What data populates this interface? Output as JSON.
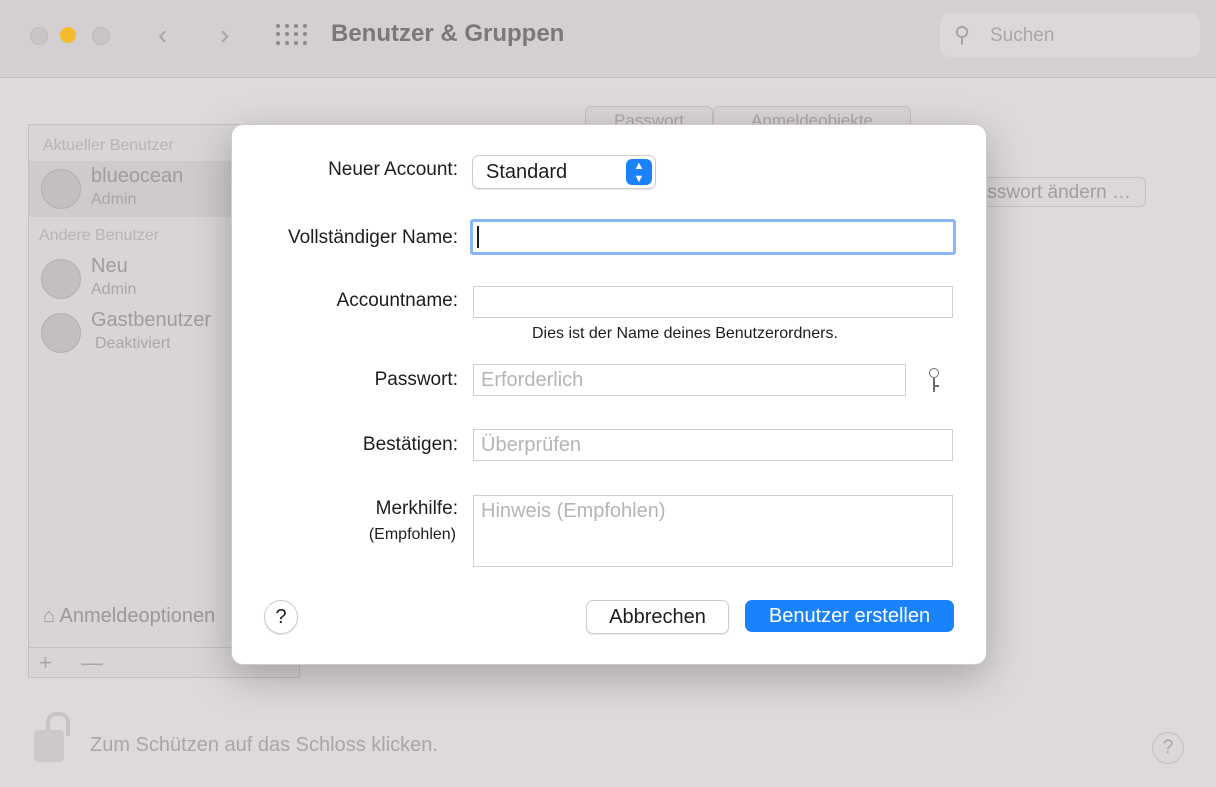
{
  "window": {
    "title": "Benutzer & Gruppen",
    "search_placeholder": "Suchen",
    "back_glyph": "‹",
    "forward_glyph": "›",
    "traffic_lights": {
      "close": "#c9c4c5",
      "minimize": "#f4bc2d",
      "zoom": "#c9c4c5"
    }
  },
  "sidebar": {
    "current_section": "Aktueller Benutzer",
    "other_section": "Andere Benutzer",
    "users": [
      {
        "name": "blueocean",
        "role": "Admin",
        "icon": "user-avatar-icon"
      },
      {
        "name": "Neu",
        "role": "Admin",
        "icon": "user-avatar-icon"
      },
      {
        "name": "Gastbenutzer",
        "role": "Deaktiviert",
        "icon": "guest-user-icon"
      }
    ],
    "login_options": "Anmeldeoptionen",
    "add": "+",
    "remove": "—"
  },
  "background": {
    "tabs": [
      "Passwort",
      "Anmeldeobjekte"
    ],
    "change_password": "Passwort ändern …",
    "lock_text": "Zum Schützen auf das Schloss klicken.",
    "help": "?"
  },
  "dialog": {
    "account_type_label": "Neuer Account:",
    "account_type_value": "Standard",
    "fullname_label": "Vollständiger Name:",
    "fullname_value": "",
    "accountname_label": "Accountname:",
    "accountname_value": "",
    "accountname_hint": "Dies ist der Name deines Benutzerordners.",
    "password_label": "Passwort:",
    "password_placeholder": "Erforderlich",
    "verify_label": "Bestätigen:",
    "verify_placeholder": "Überprüfen",
    "hint_label": "Merkhilfe:",
    "hint_sublabel": "(Empfohlen)",
    "hint_placeholder": "Hinweis (Empfohlen)",
    "help": "?",
    "cancel": "Abbrechen",
    "create": "Benutzer erstellen",
    "accent_color": "#1a82fb"
  }
}
